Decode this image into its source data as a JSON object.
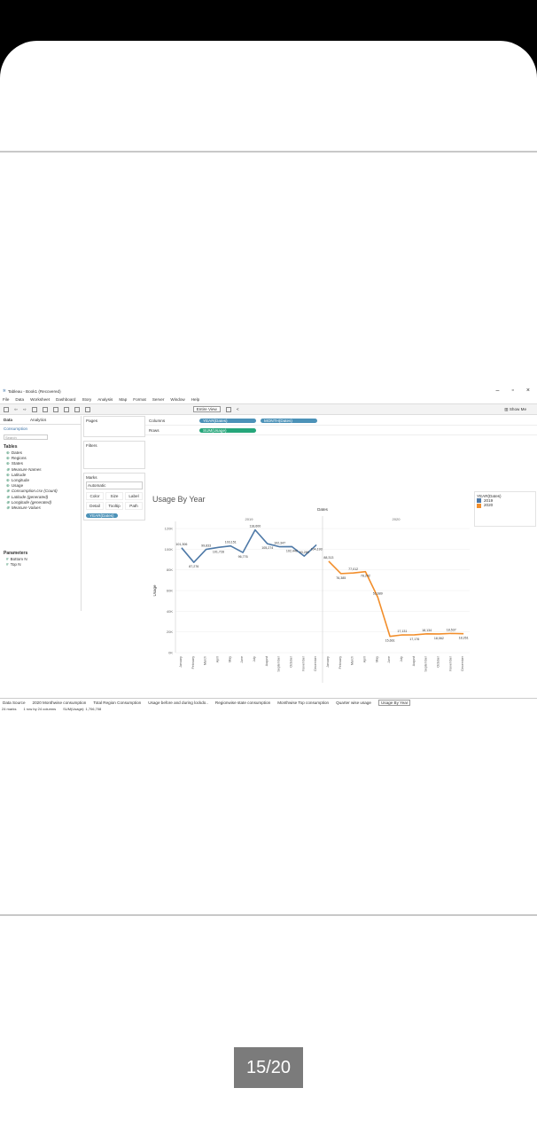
{
  "page": {
    "pager": "15/20"
  },
  "app": {
    "title": "Tableau - Book1 (Recovered)",
    "window_controls": [
      "–",
      "▫",
      "×"
    ],
    "menu": [
      "File",
      "Data",
      "Worksheet",
      "Dashboard",
      "Story",
      "Analysis",
      "Map",
      "Format",
      "Server",
      "Window",
      "Help"
    ],
    "toolbar": {
      "view_select": "Entire View",
      "show_me": "Show Me"
    }
  },
  "data_pane": {
    "tabs": [
      "Data",
      "Analytics"
    ],
    "source": "Consumption",
    "search_placeholder": "Search",
    "tables_heading": "Tables",
    "fields": [
      {
        "label": "Dates",
        "italic": false
      },
      {
        "label": "Regions",
        "italic": false
      },
      {
        "label": "States",
        "italic": false
      },
      {
        "label": "Measure Names",
        "italic": true
      },
      {
        "label": "Latitude",
        "italic": false
      },
      {
        "label": "Longitude",
        "italic": false
      },
      {
        "label": "Usage",
        "italic": false
      },
      {
        "label": "Consumption.csv (Count)",
        "italic": true
      },
      {
        "label": "Latitude (generated)",
        "italic": true
      },
      {
        "label": "Longitude (generated)",
        "italic": true
      },
      {
        "label": "Measure Values",
        "italic": true
      }
    ],
    "params_heading": "Parameters",
    "params": [
      "Bottom N",
      "Top N"
    ]
  },
  "cards": {
    "pages": "Pages",
    "filters": "Filters",
    "marks": "Marks",
    "marks_type": "Automatic",
    "mark_buttons": [
      "Color",
      "Size",
      "Label",
      "Detail",
      "Tooltip",
      "Path"
    ],
    "color_pill": "YEAR(Dates)"
  },
  "shelves": {
    "columns_label": "Columns",
    "rows_label": "Rows",
    "columns_pills": [
      "YEAR(Dates)",
      "MONTH(Dates)"
    ],
    "rows_pills": [
      "SUM(Usage)"
    ]
  },
  "colors": {
    "y2019": "#4e79a7",
    "y2020": "#f28e2b"
  },
  "chart_data": {
    "type": "line",
    "title": "Usage By Year",
    "header": "Dates",
    "ylabel": "Usage",
    "ylim": [
      0,
      120000
    ],
    "yticks": [
      "0K",
      "20K",
      "40K",
      "60K",
      "80K",
      "100K",
      "120K"
    ],
    "categories": [
      "January",
      "February",
      "March",
      "April",
      "May",
      "June",
      "July",
      "August",
      "September",
      "October",
      "November",
      "December"
    ],
    "series": [
      {
        "name": "2019",
        "values": [
          101306,
          87276,
          99833,
          101728,
          103151,
          96776,
          118600,
          105274,
          102347,
          102440,
          93289,
          104193
        ],
        "labels": [
          "101,306",
          "87,276",
          "99,833",
          "101,728",
          "103,151",
          "96,776",
          "118,600",
          "105,274",
          "102,347",
          "102,440",
          "93,289",
          "104,193"
        ]
      },
      {
        "name": "2020",
        "values": [
          88313,
          76385,
          77012,
          78242,
          53689,
          15661,
          17131,
          17176,
          18134,
          18062,
          18537,
          18261
        ],
        "labels": [
          "88,313",
          "76,385",
          "77,012",
          "78,242",
          "53,689",
          "15,661",
          "17,131",
          "17,176",
          "18,134",
          "18,062",
          "18,537",
          "18,261"
        ]
      }
    ],
    "legend_title": "YEAR(Dates)",
    "legend_position": "top-right"
  },
  "sheet_tabs": [
    "Data Source",
    "2020 Monthwise consumption",
    "Total Region Consumption",
    "Usage before and during lockdo..",
    "Regionwise state consumption",
    "Monthwise Top consumption",
    "Quarter wise usage",
    "Usage By Year"
  ],
  "status_bar": [
    "24 marks",
    "1 row by 24 columns",
    "SUM(Usage): 1,706,708"
  ]
}
